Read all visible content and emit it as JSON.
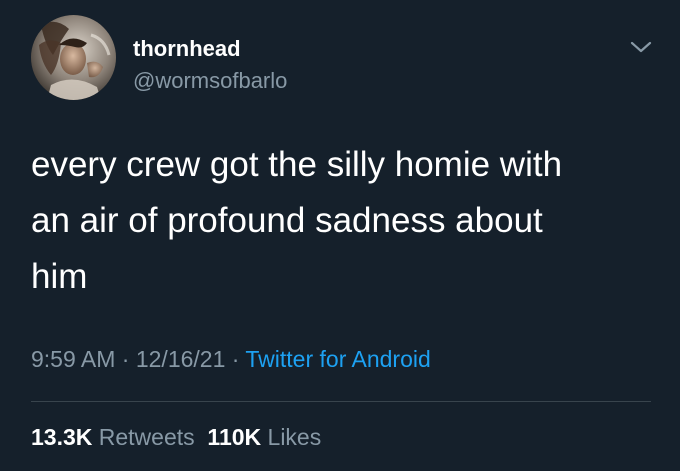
{
  "user": {
    "display_name": "thornhead",
    "handle": "@wormsofbarlo",
    "avatar_icon": "profile-photo"
  },
  "tweet": {
    "line1": "every crew got the silly homie with",
    "line2": "an air of profound sadness about",
    "line3": "him"
  },
  "meta": {
    "time": "9:59 AM",
    "sep1": " · ",
    "date": "12/16/21",
    "sep2": " · ",
    "source": "Twitter for Android"
  },
  "stats": {
    "retweets_count": "13.3K",
    "retweets_label": "Retweets",
    "likes_count": "110K",
    "likes_label": "Likes"
  },
  "colors": {
    "background": "#15202b",
    "text": "#ffffff",
    "secondary": "#8899a6",
    "link": "#1da1f2",
    "divider": "#38444d"
  },
  "icons": {
    "menu": "chevron-down-icon"
  }
}
